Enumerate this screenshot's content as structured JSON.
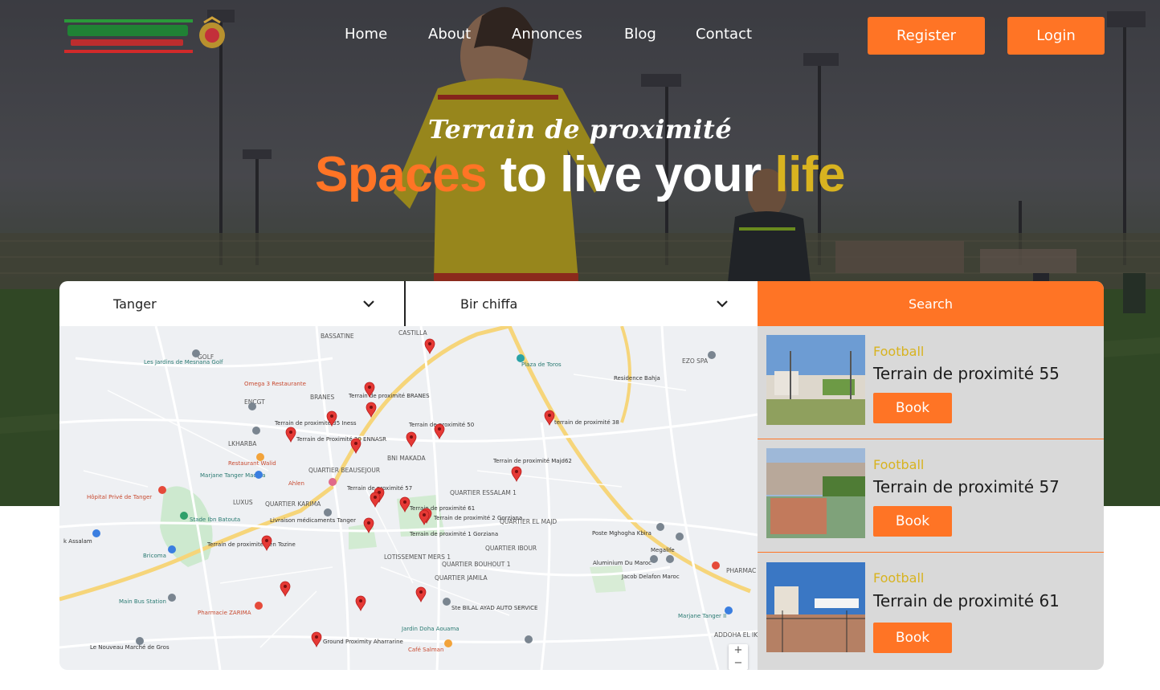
{
  "header": {
    "nav": [
      "Home",
      "About",
      "Annonces",
      "Blog",
      "Contact"
    ],
    "register_label": "Register",
    "login_label": "Login"
  },
  "hero": {
    "tagline": "Terrain de proximité",
    "headline": {
      "w1": "Spaces",
      "w2": "to live your",
      "w3": "life"
    }
  },
  "search": {
    "city": "Tanger",
    "district": "Bir chiffa",
    "button_label": "Search"
  },
  "map": {
    "labels": [
      "BASSATINE",
      "CASTILLA",
      "Plaza de Toros",
      "Les Jardins de Mesnana Golf",
      "GOLF",
      "Omega 3 Restaurante",
      "ENCGT",
      "BRANES",
      "Terrain de proximité BRANES",
      "Terrain de proximité 50",
      "terrain de proximité 38",
      "EZO SPA",
      "Residence Bahja",
      "Terrain de proximité 35 Iness",
      "Terrain de Proximité 20 ENNASR",
      "LKHARBA",
      "BNI MAKADA",
      "Terrain de proximité Majd62",
      "QUARTIER BEAUSEJOUR",
      "Marjane Tanger Madina",
      "Restaurant Walid",
      "Ahlen",
      "Hôpital Privé de Tanger",
      "Stade Ibn Batouta",
      "LUXUS",
      "QUARTIER KARIMA",
      "Terrain de proximité 57",
      "QUARTIER ESSALAM 1",
      "Terrain de proximité 61",
      "Terrain de proximité 2 Gorziana",
      "Terrain de proximité 1 Gorziana",
      "QUARTIER EL MAJD",
      "Livraison médicaments Tanger",
      "QUARTIER IBOUR",
      "LOTISSEMENT MERS 1",
      "QUARTIER BOUHOUT 1",
      "QUARTIER JAMILA",
      "Poste Mghogha Kbira",
      "Megalife",
      "Aluminium Du Maroc",
      "Jacob Delafon Maroc",
      "PHARMAC",
      "k Assalam",
      "Bricoma",
      "Terrain de proximité Ben Tozine",
      "Main Bus Station",
      "Pharmacie ZARIMA",
      "Ste BILAL AYAD AUTO SERVICE",
      "Marjane Tanger II",
      "Jardin Doha Aouama",
      "Café Salman",
      "Ground Proximity Aharrarine",
      "Le Nouveau Marché de Gros",
      "ADDOHA EL IKHLASS"
    ],
    "zoom_in": "+",
    "zoom_out": "−"
  },
  "results": [
    {
      "sport": "Football",
      "name": "Terrain de proximité 55",
      "book_label": "Book"
    },
    {
      "sport": "Football",
      "name": "Terrain de proximité 57",
      "book_label": "Book"
    },
    {
      "sport": "Football",
      "name": "Terrain de proximité 61",
      "book_label": "Book"
    }
  ],
  "colors": {
    "accent": "#ff7425",
    "sport": "#d8b320",
    "panel": "#d9d9d9"
  }
}
